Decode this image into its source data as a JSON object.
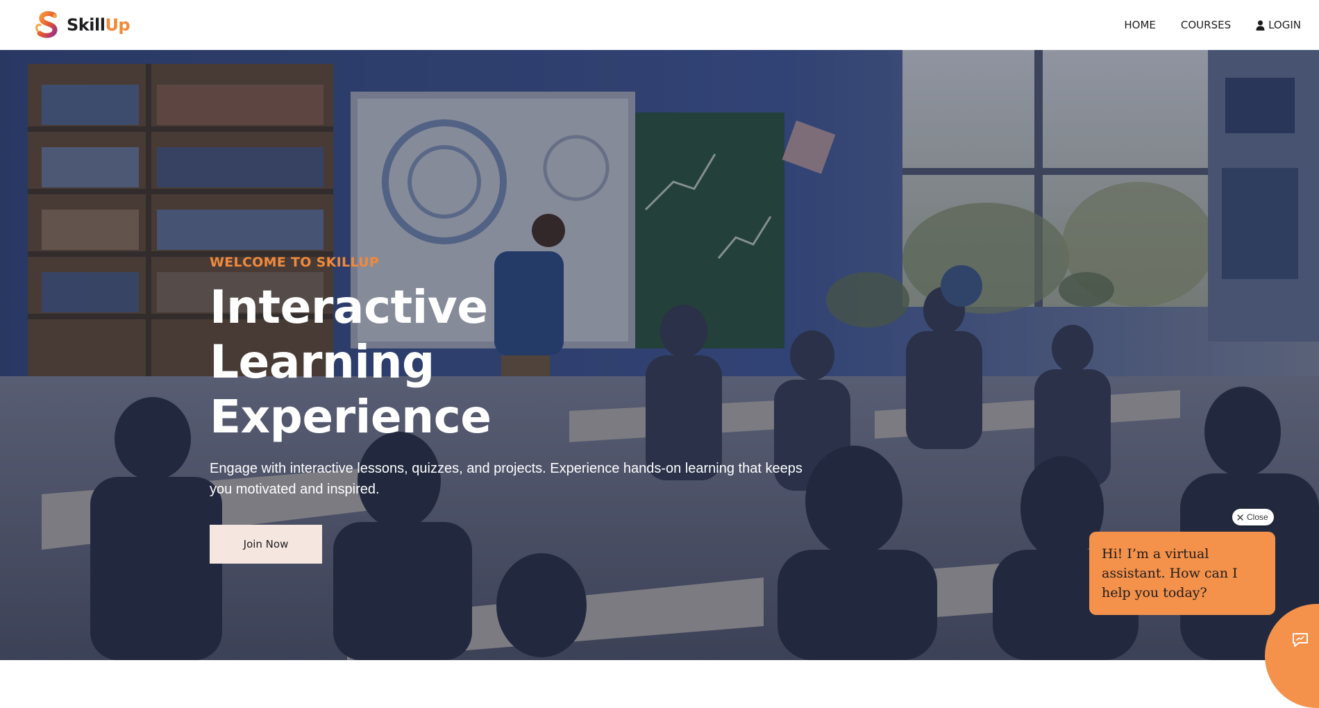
{
  "brand": {
    "name_part1": "Skill",
    "name_part2": "Up",
    "logo_icon": "s-swirl-logo-icon",
    "accent_color": "#f08a3c"
  },
  "nav": {
    "items": [
      {
        "label": "HOME"
      },
      {
        "label": "COURSES"
      },
      {
        "label": "LOGIN",
        "icon": "user-icon"
      }
    ]
  },
  "hero": {
    "background": "classroom-illustration",
    "eyebrow": "WELCOME TO SKILLUP",
    "title": "Interactive Learning Experience",
    "description": "Engage with interactive lessons, quizzes, and projects. Experience hands-on learning that keeps you motivated and inspired.",
    "cta_label": "Join Now"
  },
  "chat": {
    "close_label": "Close",
    "close_icon": "x-icon",
    "message": "Hi! I’m a virtual assistant. How can I help you today?",
    "launcher_icon": "chat-bubble-icon",
    "color": "#f4914a"
  }
}
